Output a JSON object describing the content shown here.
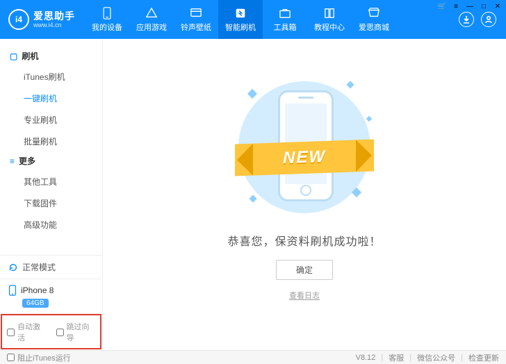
{
  "brand": {
    "name": "爱思助手",
    "url": "www.i4.cn",
    "logo_text": "i4"
  },
  "nav": {
    "items": [
      {
        "label": "我的设备",
        "icon": "device"
      },
      {
        "label": "应用游戏",
        "icon": "apps"
      },
      {
        "label": "铃声壁纸",
        "icon": "music"
      },
      {
        "label": "智能刷机",
        "icon": "flash",
        "active": true
      },
      {
        "label": "工具箱",
        "icon": "toolbox"
      },
      {
        "label": "教程中心",
        "icon": "book"
      },
      {
        "label": "爱思商城",
        "icon": "shop"
      }
    ]
  },
  "sidebar": {
    "groups": [
      {
        "title": "刷机",
        "icon": "flash",
        "items": [
          {
            "label": "iTunes刷机"
          },
          {
            "label": "一键刷机",
            "active": true
          },
          {
            "label": "专业刷机"
          },
          {
            "label": "批量刷机"
          }
        ]
      },
      {
        "title": "更多",
        "icon": "more",
        "items": [
          {
            "label": "其他工具"
          },
          {
            "label": "下载固件"
          },
          {
            "label": "高级功能"
          }
        ]
      }
    ],
    "status": {
      "label": "正常模式"
    },
    "device": {
      "name": "iPhone 8",
      "storage": "64GB"
    },
    "checks": {
      "auto_activate": "自动激活",
      "skip_guide": "跳过向导"
    }
  },
  "main": {
    "ribbon": "NEW",
    "message": "恭喜您，保资料刷机成功啦！",
    "ok": "确定",
    "log": "查看日志"
  },
  "footer": {
    "block_itunes": "阻止iTunes运行",
    "version": "V8.12",
    "support": "客服",
    "wechat": "微信公众号",
    "update": "检查更新"
  }
}
